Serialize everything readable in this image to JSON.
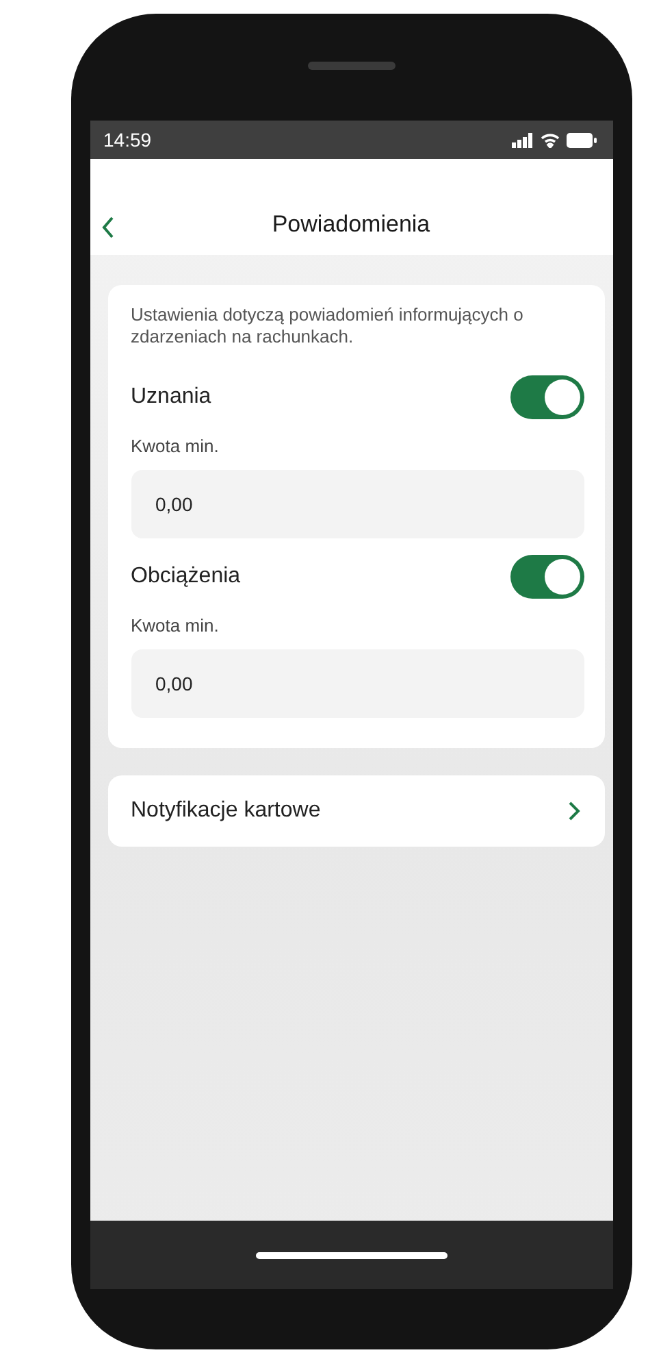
{
  "status_bar": {
    "time": "14:59"
  },
  "header": {
    "title": "Powiadomienia"
  },
  "settings": {
    "description": "Ustawienia dotyczą powiadomień informujących o zdarzeniach na rachunkach.",
    "items": [
      {
        "label": "Uznania",
        "on": true,
        "amount_label": "Kwota min.",
        "amount": "0,00"
      },
      {
        "label": "Obciążenia",
        "on": true,
        "amount_label": "Kwota min.",
        "amount": "0,00"
      }
    ]
  },
  "links": [
    {
      "label": "Notyfikacje kartowe"
    }
  ]
}
